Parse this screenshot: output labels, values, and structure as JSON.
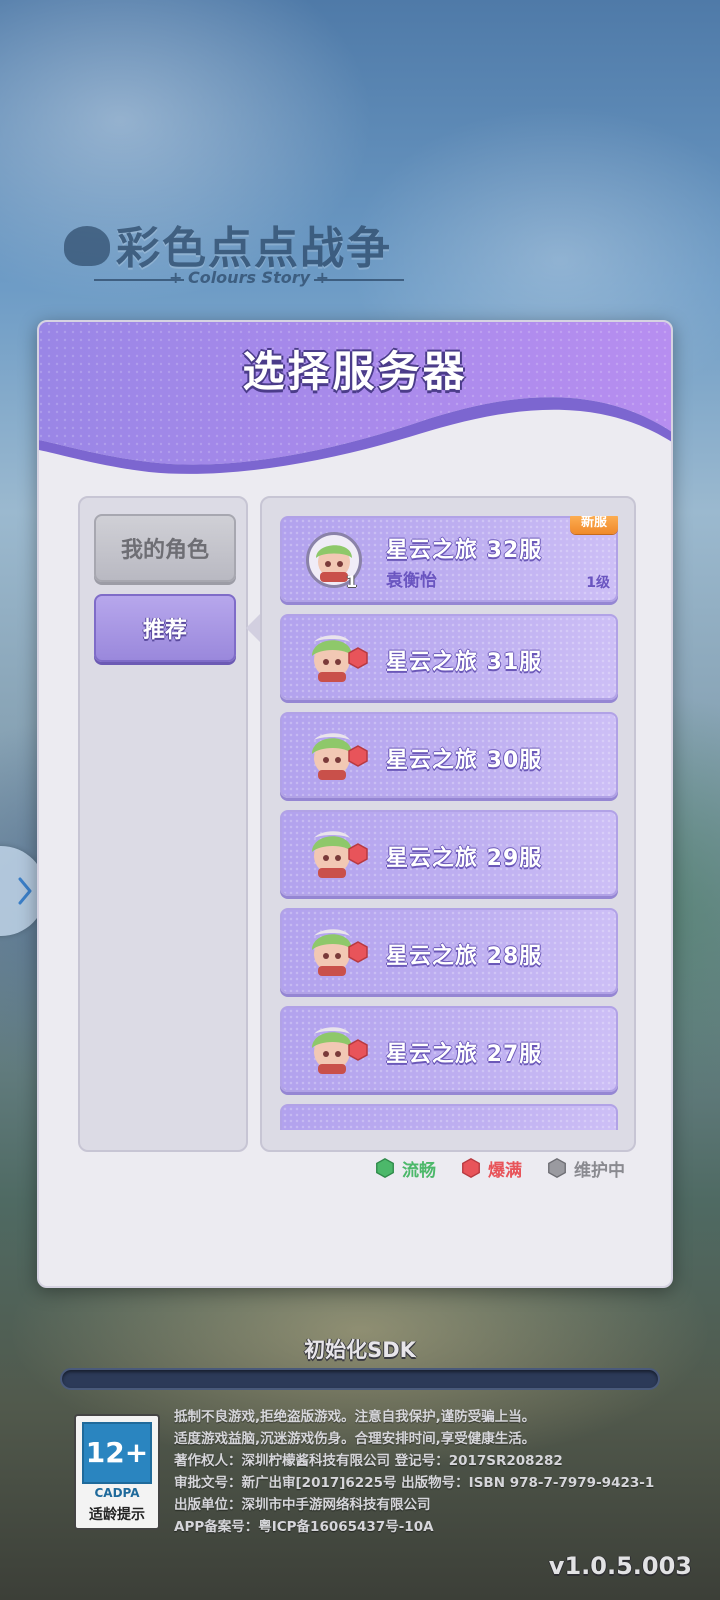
{
  "background": {
    "logo_title": "彩色点点战争",
    "logo_subtitle": "+ Colours Story +"
  },
  "dialog": {
    "title": "选择服务器",
    "tabs": [
      {
        "label": "我的角色",
        "selected": false
      },
      {
        "label": "推荐",
        "selected": true
      }
    ],
    "servers": [
      {
        "name": "星云之旅 32服",
        "role": "袁衡怡",
        "level": "1级",
        "avatar_level": "1",
        "badge": "新服",
        "status": "my-role"
      },
      {
        "name": "星云之旅 31服",
        "status": "full"
      },
      {
        "name": "星云之旅 30服",
        "status": "full"
      },
      {
        "name": "星云之旅 29服",
        "status": "full"
      },
      {
        "name": "星云之旅 28服",
        "status": "full"
      },
      {
        "name": "星云之旅 27服",
        "status": "full"
      }
    ],
    "legend": [
      {
        "label": "流畅",
        "color": "#4cb86a"
      },
      {
        "label": "爆满",
        "color": "#e8545a"
      },
      {
        "label": "维护中",
        "color": "#9a9aa0"
      }
    ]
  },
  "loading": {
    "label": "初始化SDK",
    "progress_fraction": 0.0
  },
  "age_rating": {
    "rating": "12+",
    "org": "CADPA",
    "hint": "适龄提示"
  },
  "legal": [
    "抵制不良游戏,拒绝盗版游戏。注意自我保护,谨防受骗上当。",
    "适度游戏益脑,沉迷游戏伤身。合理安排时间,享受健康生活。",
    "著作权人：深圳柠檬酱科技有限公司 登记号：2017SR208282",
    "审批文号：新广出审[2017]6225号 出版物号：ISBN 978-7-7979-9423-1",
    "出版单位：深圳市中手游网络科技有限公司",
    "APP备案号：粤ICP备16065437号-10A"
  ],
  "version": "v1.0.5.003",
  "colors": {
    "accent_purple": "#9a88dc",
    "header_purple": "#a08ae8",
    "status_green": "#4cb86a",
    "status_red": "#e8545a",
    "status_gray": "#9a9aa0"
  }
}
